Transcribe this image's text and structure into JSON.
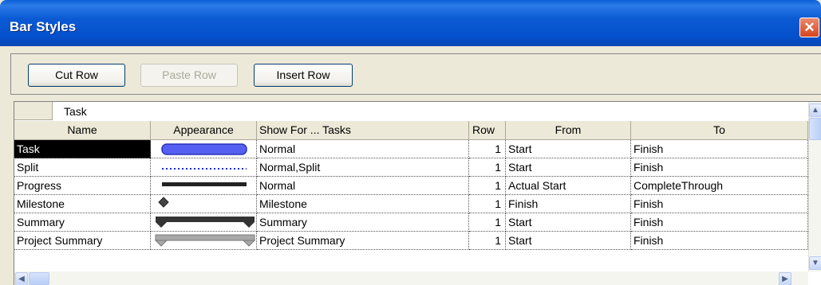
{
  "window": {
    "title": "Bar Styles"
  },
  "toolbar": {
    "cut_row": "Cut Row",
    "paste_row": "Paste Row",
    "insert_row": "Insert Row"
  },
  "grid": {
    "edit_value": "Task",
    "columns": [
      "Name",
      "Appearance",
      "Show For ... Tasks",
      "Row",
      "From",
      "To"
    ],
    "rows": [
      {
        "name": "Task",
        "appearance": "blue-rounded-bar",
        "show_for": "Normal",
        "row": "1",
        "from": "Start",
        "to": "Finish"
      },
      {
        "name": "Split",
        "appearance": "blue-dotted-line",
        "show_for": "Normal,Split",
        "row": "1",
        "from": "Start",
        "to": "Finish"
      },
      {
        "name": "Progress",
        "appearance": "black-thin-bar",
        "show_for": "Normal",
        "row": "1",
        "from": "Actual Start",
        "to": "CompleteThrough"
      },
      {
        "name": "Milestone",
        "appearance": "diamond",
        "show_for": "Milestone",
        "row": "1",
        "from": "Finish",
        "to": "Finish"
      },
      {
        "name": "Summary",
        "appearance": "black-summary-bar",
        "show_for": "Summary",
        "row": "1",
        "from": "Start",
        "to": "Finish"
      },
      {
        "name": "Project Summary",
        "appearance": "gray-summary-bar",
        "show_for": "Project Summary",
        "row": "1",
        "from": "Start",
        "to": "Finish"
      }
    ]
  }
}
